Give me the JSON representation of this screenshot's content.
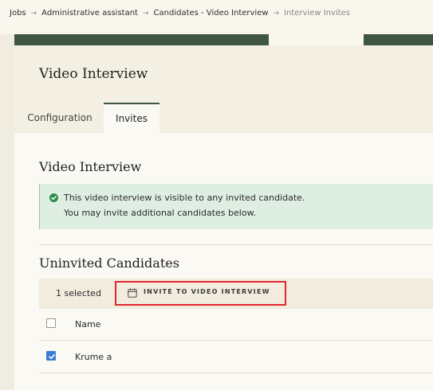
{
  "breadcrumb": {
    "items": [
      "Jobs",
      "Administrative assistant",
      "Candidates - Video Interview",
      "Interview Invites"
    ],
    "separator": "→"
  },
  "header": {
    "title": "Video Interview"
  },
  "tabs": [
    {
      "label": "Configuration",
      "active": false
    },
    {
      "label": "Invites",
      "active": true
    }
  ],
  "section": {
    "title": "Video Interview",
    "alert": {
      "line1": "This video interview is visible to any invited candidate.",
      "line2": "You may invite additional candidates below.",
      "icon": "check-circle-icon",
      "color": "#2e8b47"
    }
  },
  "uninvited": {
    "title": "Uninvited Candidates",
    "selected_label": "1 selected",
    "invite_button": {
      "label": "INVITE TO VIDEO INTERVIEW",
      "icon": "calendar-icon"
    },
    "columns": [
      "Name"
    ],
    "rows": [
      {
        "name": "Krume a",
        "checked": true
      }
    ]
  },
  "colors": {
    "accent": "#3f5644",
    "checkbox_checked": "#3b7bd6",
    "highlight_border": "#e0262e"
  }
}
